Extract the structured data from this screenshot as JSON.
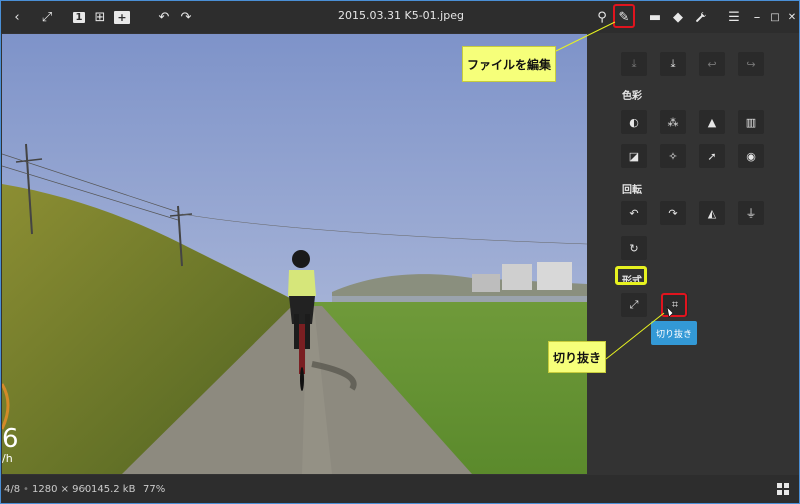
{
  "window": {
    "title": "2015.03.31 K5-01.jpeg"
  },
  "toolbar_left": [
    {
      "name": "back-icon",
      "glyph": "‹"
    },
    {
      "name": "fullscreen-icon",
      "glyph": "⤢"
    },
    {
      "name": "single-view-icon",
      "glyph": "1"
    },
    {
      "name": "grid-view-icon",
      "glyph": "⊞"
    },
    {
      "name": "add-icon",
      "glyph": "+"
    },
    {
      "name": "undo-icon",
      "glyph": "↶"
    },
    {
      "name": "redo-icon",
      "glyph": "↷"
    }
  ],
  "toolbar_right": [
    {
      "name": "location-icon",
      "glyph": "⚲"
    },
    {
      "name": "edit-file-icon",
      "glyph": "✎"
    },
    {
      "name": "comment-icon",
      "glyph": "▬"
    },
    {
      "name": "tag-icon",
      "glyph": "◆"
    },
    {
      "name": "wrench-icon",
      "glyph": "🔧"
    },
    {
      "name": "menu-icon",
      "glyph": "☰"
    },
    {
      "name": "minimize-icon",
      "glyph": "–"
    },
    {
      "name": "maximize-icon",
      "glyph": "□"
    },
    {
      "name": "close-icon",
      "glyph": "✕"
    }
  ],
  "panel": {
    "top_tools": [
      {
        "name": "export-icon",
        "glyph": "⤓",
        "dim": true
      },
      {
        "name": "save-icon",
        "glyph": "⤓",
        "dim": false
      },
      {
        "name": "panel-undo-icon",
        "glyph": "↩",
        "dim": true
      },
      {
        "name": "panel-redo-icon",
        "glyph": "↪",
        "dim": true
      }
    ],
    "section_color": "色彩",
    "color_tools": [
      {
        "name": "contrast-icon",
        "glyph": "◐"
      },
      {
        "name": "saturation-icon",
        "glyph": "⁂"
      },
      {
        "name": "sharpen-icon",
        "glyph": "▲"
      },
      {
        "name": "levels-icon",
        "glyph": "▥"
      },
      {
        "name": "curves-icon",
        "glyph": "◪"
      },
      {
        "name": "auto-fix-icon",
        "glyph": "✧"
      },
      {
        "name": "brush-icon",
        "glyph": "➚"
      },
      {
        "name": "redeye-icon",
        "glyph": "◉"
      }
    ],
    "section_rotate": "回転",
    "rotate_tools": [
      {
        "name": "rotate-left-icon",
        "glyph": "↶"
      },
      {
        "name": "rotate-right-icon",
        "glyph": "↷"
      },
      {
        "name": "flip-horizontal-icon",
        "glyph": "◭"
      },
      {
        "name": "flip-vertical-icon",
        "glyph": "⏚"
      },
      {
        "name": "rotate-free-icon",
        "glyph": "↻"
      }
    ],
    "section_form": "形式",
    "form_tools": [
      {
        "name": "resize-icon",
        "glyph": "⤢"
      },
      {
        "name": "crop-icon",
        "glyph": "⌗"
      }
    ],
    "tooltip": "切り抜き"
  },
  "callouts": {
    "edit_file": "ファイルを編集",
    "crop": "切り抜き"
  },
  "photo_overlay": {
    "speed_digit": "6",
    "speed_unit": "/h"
  },
  "status": {
    "index": "4/8",
    "dimensions": "1280 × 960",
    "filesize": "145.2 kB",
    "zoom": "77%"
  },
  "colors": {
    "accent_red": "#e0141e",
    "highlight_yellow": "#e7f220",
    "tooltip_blue": "#3399d6",
    "callout_bg": "#f6ff7a"
  }
}
